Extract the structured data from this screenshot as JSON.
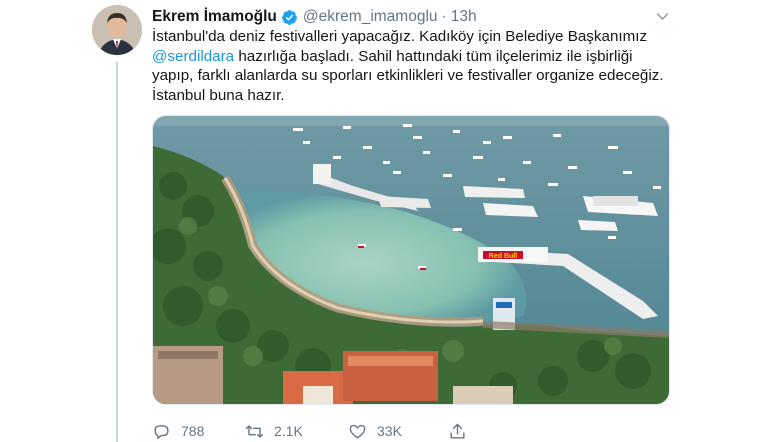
{
  "tweet": {
    "author_name": "Ekrem İmamoğlu",
    "handle": "@ekrem_imamoglu",
    "separator": "·",
    "time": "13h",
    "text_before_mention": "İstanbul'da deniz festivalleri yapacağız. Kadıköy için Belediye Başkanımız ",
    "mention": "@serdildara",
    "text_after_mention": " hazırlığa başladı. Sahil hattındaki tüm ilçelerimiz ile işbirliği yapıp, farklı alanlarda su sporları etkinlikleri ve festivaller organize edeceğiz. İstanbul buna hazır.",
    "media_banner_text": "Red Bull"
  },
  "actions": {
    "replies": "788",
    "retweets": "2.1K",
    "likes": "33K"
  },
  "icons": {
    "verified": "verified-badge-icon",
    "caret": "chevron-down-icon",
    "reply": "reply-icon",
    "retweet": "retweet-icon",
    "like": "heart-icon",
    "share": "share-icon"
  },
  "colors": {
    "accent": "#1da1f2",
    "mention": "#1b95e0",
    "muted": "#657786",
    "text": "#14171a",
    "line": "#ccd6dd"
  }
}
